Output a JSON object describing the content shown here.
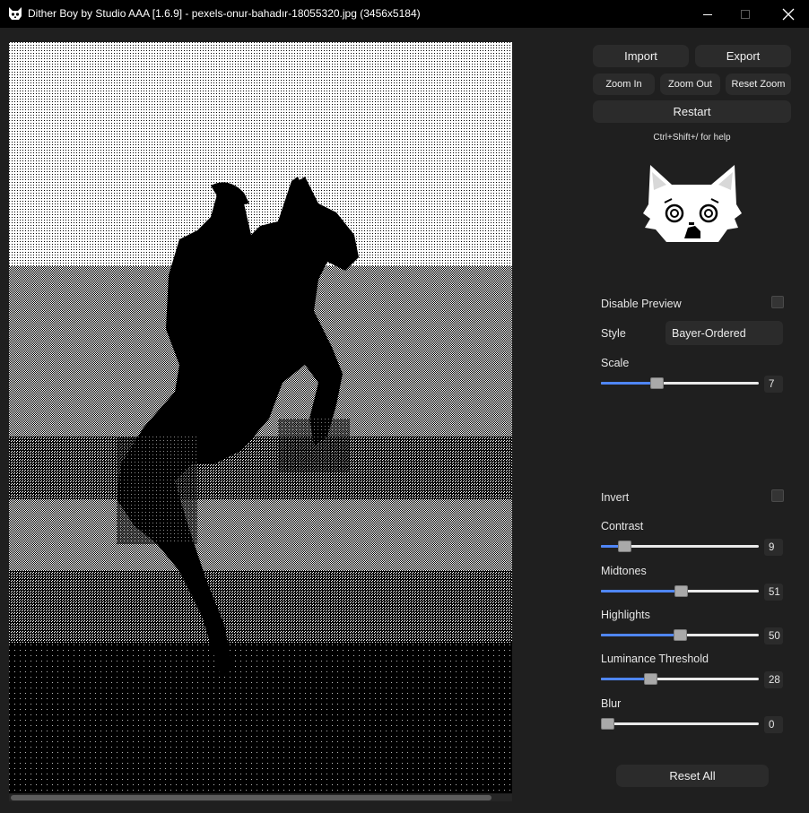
{
  "window": {
    "title": "Dither Boy by Studio AAA [1.6.9] - pexels-onur-bahadır-18055320.jpg (3456x5184)",
    "minimize_icon": "minimize-icon",
    "maximize_icon": "maximize-icon",
    "close_icon": "close-icon"
  },
  "toolbar": {
    "import_label": "Import",
    "export_label": "Export",
    "zoom_in_label": "Zoom In",
    "zoom_out_label": "Zoom Out",
    "reset_zoom_label": "Reset Zoom",
    "restart_label": "Restart",
    "help_text": "Ctrl+Shift+/ for help"
  },
  "settings": {
    "disable_preview_label": "Disable Preview",
    "disable_preview_checked": false,
    "style_label": "Style",
    "style_value": "Bayer-Ordered",
    "scale": {
      "label": "Scale",
      "value": "7",
      "fraction": 0.34
    },
    "invert_label": "Invert",
    "invert_checked": false,
    "contrast": {
      "label": "Contrast",
      "value": "9",
      "fraction": 0.12
    },
    "midtones": {
      "label": "Midtones",
      "value": "51",
      "fraction": 0.51
    },
    "highlights": {
      "label": "Highlights",
      "value": "50",
      "fraction": 0.5
    },
    "luminance_threshold": {
      "label": "Luminance Threshold",
      "value": "28",
      "fraction": 0.3
    },
    "blur": {
      "label": "Blur",
      "value": "0",
      "fraction": 0.0
    },
    "reset_all_label": "Reset All"
  },
  "colors": {
    "accent": "#4f86f7",
    "panel_bg": "#1f1f1f",
    "button_bg": "#2b2b2b",
    "titlebar_bg": "#000000"
  }
}
